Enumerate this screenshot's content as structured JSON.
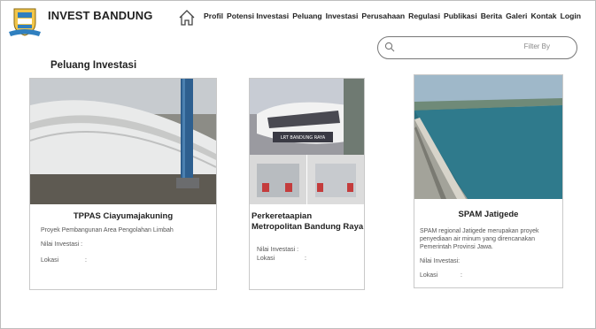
{
  "header": {
    "brand": "INVEST BANDUNG",
    "nav": [
      "Profil",
      "Potensi Investasi",
      "Peluang",
      "Investasi",
      "Perusahaan",
      "Regulasi",
      "Publikasi",
      "Berita",
      "Galeri",
      "Kontak",
      "Login"
    ]
  },
  "search": {
    "placeholder": "Filter By"
  },
  "section_title": "Peluang Investasi",
  "cards": [
    {
      "title": "TPPAS Ciayumajakuning",
      "desc": "Proyek Pembangunan Area Pengolahan Limbah",
      "nilai_label": "Nilai Investasi :",
      "lokasi_label": "Lokasi",
      "lokasi_sep": ":"
    },
    {
      "title": "Perkeretaapian Metropolitan Bandung Raya",
      "image_caption": "LRT BANDUNG RAYA",
      "nilai_label": "Nilai Investasi :",
      "lokasi_label": "Lokasi",
      "lokasi_sep": ":"
    },
    {
      "title": "SPAM Jatigede",
      "desc": "SPAM regional Jatigede merupakan proyek penyediaan air minum yang direncanakan Pemerintah Provinsi Jawa.",
      "nilai_label": "Nilai Investasi:",
      "lokasi_label": "Lokasi",
      "lokasi_sep": ":"
    }
  ]
}
